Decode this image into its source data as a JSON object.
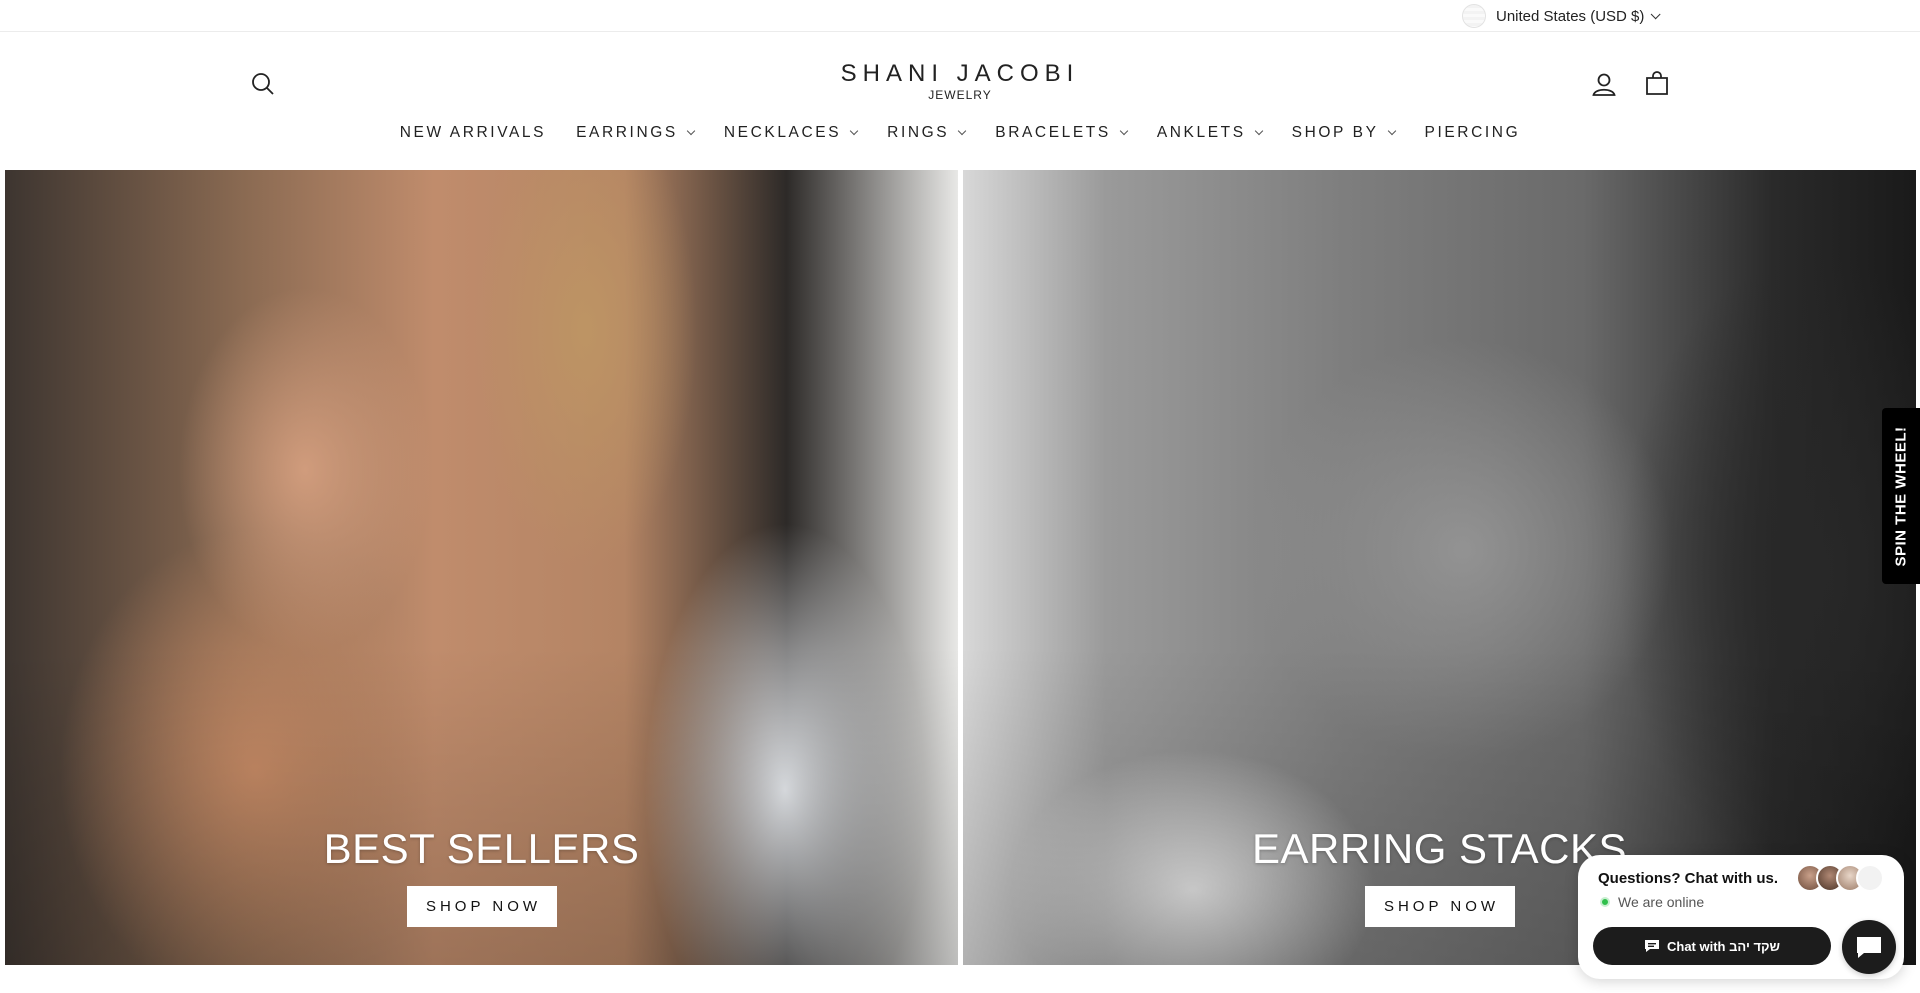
{
  "topbar": {
    "currency_label": "United States (USD $)"
  },
  "header": {
    "logo_main": "SHANI JACOBI",
    "logo_sub": "JEWELRY",
    "icons": {
      "search": "search-icon",
      "account": "user-icon",
      "cart": "cart-icon"
    }
  },
  "nav": {
    "items": [
      {
        "label": "NEW ARRIVALS",
        "dropdown": false
      },
      {
        "label": "EARRINGS",
        "dropdown": true
      },
      {
        "label": "NECKLACES",
        "dropdown": true
      },
      {
        "label": "RINGS",
        "dropdown": true
      },
      {
        "label": "BRACELETS",
        "dropdown": true
      },
      {
        "label": "ANKLETS",
        "dropdown": true
      },
      {
        "label": "SHOP BY",
        "dropdown": true
      },
      {
        "label": "PIERCING",
        "dropdown": false
      }
    ]
  },
  "hero": {
    "left": {
      "title": "BEST SELLERS",
      "button": "SHOP NOW"
    },
    "right": {
      "title": "EARRING STACKS",
      "button": "SHOP NOW"
    }
  },
  "spin_tab": {
    "label": "SPIN THE WHEEL!"
  },
  "chat": {
    "question": "Questions? Chat with us.",
    "status": "We are online",
    "button": "Chat with שקד יהב",
    "status_color": "#2fbf4b"
  }
}
